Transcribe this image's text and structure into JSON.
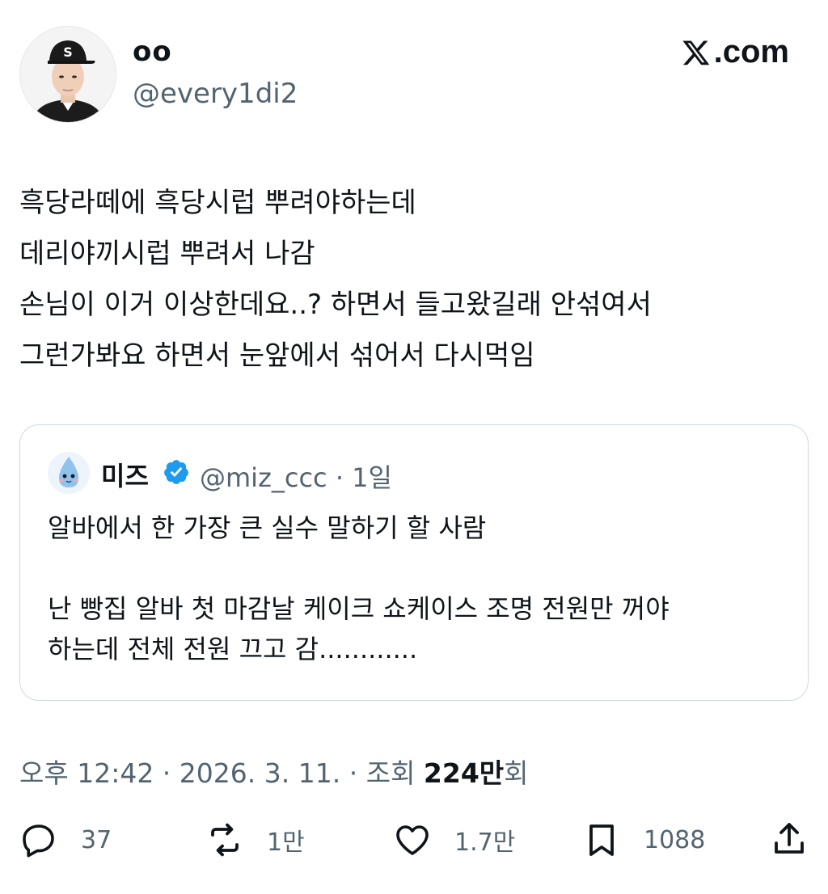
{
  "author": {
    "display_name": "oo",
    "handle": "@every1di2"
  },
  "brand": {
    "label": ".com",
    "icon": "x-logo-icon"
  },
  "tweet": {
    "lines": [
      "흑당라떼에 흑당시럽 뿌려야하는데",
      "데리야끼시럽 뿌려서 나감",
      "손님이 이거 이상한데요..? 하면서 들고왔길래 안섞여서",
      "그런가봐요 하면서 눈앞에서 섞어서 다시먹임"
    ]
  },
  "quote": {
    "name": "미즈",
    "verified_icon": "verified-badge-icon",
    "handle_time": "@miz_ccc · 1일",
    "lines": [
      "알바에서 한 가장 큰 실수 말하기 할 사람",
      "",
      "난 빵집 알바 첫 마감날 케이크 쇼케이스 조명 전원만 꺼야",
      "하는데 전체 전원 끄고 감............"
    ]
  },
  "meta": {
    "time": "오후 12:42",
    "sep1": " · ",
    "date": "2026. 3. 11.",
    "sep2": " · ",
    "views_prefix": "조회 ",
    "views_count": "224만",
    "views_suffix": "회"
  },
  "actions": {
    "reply": {
      "icon": "reply-icon",
      "count": "37"
    },
    "retweet": {
      "icon": "retweet-icon",
      "count": "1만"
    },
    "like": {
      "icon": "heart-icon",
      "count": "1.7만"
    },
    "bookmark": {
      "icon": "bookmark-icon",
      "count": "1088"
    },
    "share": {
      "icon": "share-icon"
    }
  },
  "colors": {
    "text": "#0f1419",
    "secondary": "#536471",
    "border": "#cfd9de",
    "verified": "#1d9bf0"
  }
}
